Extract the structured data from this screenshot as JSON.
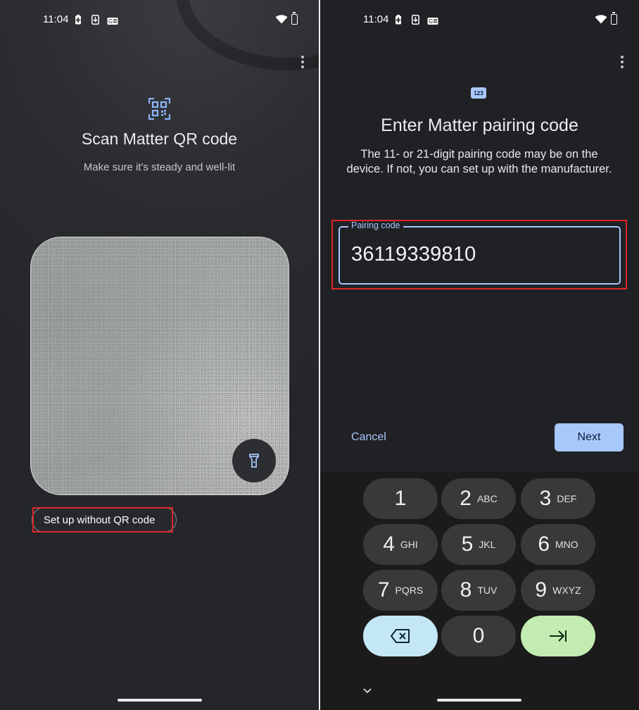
{
  "left": {
    "status": {
      "time": "11:04"
    },
    "title": "Scan Matter QR code",
    "subtitle": "Make sure it's steady and well-lit",
    "setup_without_qr": "Set up without QR code",
    "icons": {
      "header": "qr-code-scan-icon",
      "flashlight": "flashlight-icon",
      "menu": "more-vert-icon"
    }
  },
  "right": {
    "status": {
      "time": "11:04"
    },
    "badge": "123",
    "title": "Enter Matter pairing code",
    "description": "The 11- or 21-digit pairing code may be on the device. If not, you can set up with the manufacturer.",
    "field": {
      "label": "Pairing code",
      "value": "36119339810"
    },
    "cancel_label": "Cancel",
    "next_label": "Next",
    "keypad": [
      {
        "digit": "1",
        "letters": ""
      },
      {
        "digit": "2",
        "letters": "ABC"
      },
      {
        "digit": "3",
        "letters": "DEF"
      },
      {
        "digit": "4",
        "letters": "GHI"
      },
      {
        "digit": "5",
        "letters": "JKL"
      },
      {
        "digit": "6",
        "letters": "MNO"
      },
      {
        "digit": "7",
        "letters": "PQRS"
      },
      {
        "digit": "8",
        "letters": "TUV"
      },
      {
        "digit": "9",
        "letters": "WXYZ"
      },
      {
        "digit": "0",
        "letters": ""
      }
    ],
    "icons": {
      "backspace": "backspace-icon",
      "enter": "tab-next-icon",
      "hide_keyboard": "chevron-down-icon"
    }
  },
  "colors": {
    "accent": "#a8c7fa",
    "highlight": "#e0262a",
    "backspace_key": "#c4e7f5",
    "enter_key": "#c3ecb3"
  }
}
